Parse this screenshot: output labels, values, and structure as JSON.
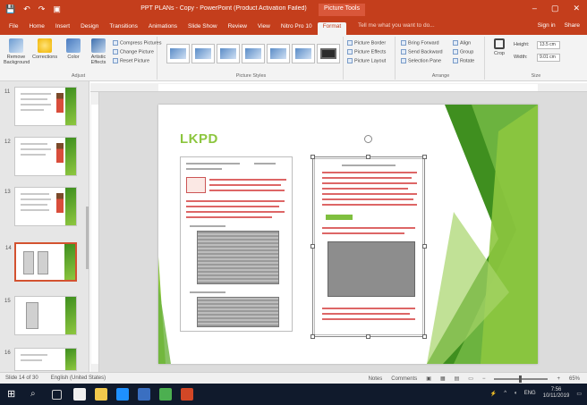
{
  "window": {
    "title": "PPT PLANs - Copy - PowerPoint (Product Activation Failed)",
    "context_tab": "Picture Tools",
    "controls": [
      "–",
      "▢",
      "✕"
    ]
  },
  "quick_access": [
    "💾",
    "↶",
    "↷",
    "▣"
  ],
  "ribbon": {
    "tabs": [
      "File",
      "Home",
      "Insert",
      "Design",
      "Transitions",
      "Animations",
      "Slide Show",
      "Review",
      "View",
      "Nitro Pro 10",
      "Format"
    ],
    "active_tab": "Format",
    "tell_me": "Tell me what you want to do...",
    "sign_in": "Sign in",
    "share": "Share",
    "adjust": {
      "label": "Adjust",
      "remove_background": "Remove Background",
      "corrections": "Corrections",
      "color": "Color",
      "artistic_effects": "Artistic Effects",
      "compress": "Compress Pictures",
      "change": "Change Picture",
      "reset": "Reset Picture"
    },
    "picture_styles": {
      "label": "Picture Styles",
      "count": 7
    },
    "picture_options": {
      "border": "Picture Border",
      "effects": "Picture Effects",
      "layout": "Picture Layout"
    },
    "arrange": {
      "label": "Arrange",
      "bring_forward": "Bring Forward",
      "send_backward": "Send Backward",
      "selection_pane": "Selection Pane",
      "align": "Align",
      "group": "Group",
      "rotate": "Rotate"
    },
    "size": {
      "label": "Size",
      "crop": "Crop",
      "height_label": "Height:",
      "height_value": "13.5 cm",
      "width_label": "Width:",
      "width_value": "9.01 cm"
    }
  },
  "thumbnails": [
    {
      "num": "11"
    },
    {
      "num": "12"
    },
    {
      "num": "13"
    },
    {
      "num": "14",
      "active": true
    },
    {
      "num": "15"
    },
    {
      "num": "16"
    }
  ],
  "slide": {
    "title": "LKPD",
    "accent": "#8cc63e",
    "dark_accent": "#3f8f1f"
  },
  "status": {
    "slide_info": "Slide 14 of 30",
    "language": "English (United States)",
    "notes": "Notes",
    "comments": "Comments",
    "zoom": "65%"
  },
  "taskbar": {
    "tray_lang": "ENG",
    "time": "7:56",
    "date": "10/11/2019"
  }
}
